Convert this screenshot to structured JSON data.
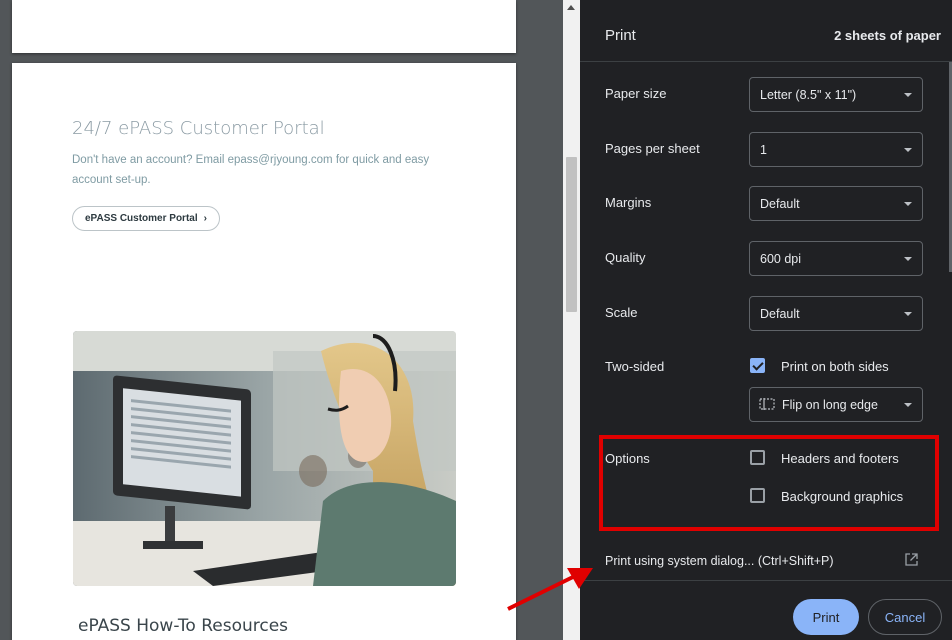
{
  "preview": {
    "portal_title": "24/7 ePASS Customer Portal",
    "portal_text": "Don't have an account? Email epass@rjyoung.com for quick and easy account set-up.",
    "portal_button": "ePASS Customer Portal",
    "resources_title": "ePASS How-To Resources"
  },
  "print": {
    "title": "Print",
    "sheets": "2 sheets of paper",
    "paper_size": {
      "label": "Paper size",
      "value": "Letter (8.5\" x 11\")"
    },
    "pages_per_sheet": {
      "label": "Pages per sheet",
      "value": "1"
    },
    "margins": {
      "label": "Margins",
      "value": "Default"
    },
    "quality": {
      "label": "Quality",
      "value": "600 dpi"
    },
    "scale": {
      "label": "Scale",
      "value": "Default"
    },
    "two_sided": {
      "label": "Two-sided",
      "checkbox": "Print on both sides",
      "checked": true,
      "flip": "Flip on long edge"
    },
    "options": {
      "label": "Options",
      "headers_footers": "Headers and footers",
      "background_graphics": "Background graphics"
    },
    "system_dialog": "Print using system dialog... (Ctrl+Shift+P)",
    "print_button": "Print",
    "cancel_button": "Cancel"
  },
  "colors": {
    "panel_bg": "#202124",
    "accent": "#8ab4f8",
    "annotation": "#e00000"
  }
}
